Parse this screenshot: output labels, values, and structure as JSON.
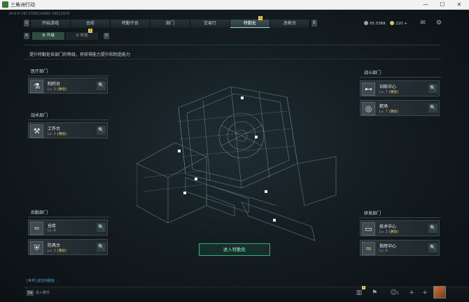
{
  "window": {
    "title": "三角洲行动",
    "min": "—",
    "max": "☐",
    "close": "✕"
  },
  "uid": "24-6-8 UID 0786524880 39521829",
  "topnav": {
    "key_left": "Q",
    "key_right": "E",
    "tabs": [
      {
        "label": "开始游戏"
      },
      {
        "label": "仓库"
      },
      {
        "label": "特勤干员"
      },
      {
        "label": "部门"
      },
      {
        "label": "交易行"
      },
      {
        "label": "特勤处",
        "badge": "1"
      },
      {
        "label": "改枪台"
      }
    ]
  },
  "stats": {
    "currency": "95.53BK",
    "coins": "220"
  },
  "subnav": {
    "key_left": "A",
    "key_right": "D",
    "tabs": [
      {
        "label": "升级"
      },
      {
        "label": "制造",
        "badge": "1"
      }
    ]
  },
  "description": "提升特勤处各部门的等级，将获得能力提升和制造能力",
  "departments": {
    "medical": {
      "label": "医疗部门",
      "items": [
        {
          "name": "制药台",
          "level": "Lv. 3",
          "max": "(满级)",
          "icon": "flask-icon"
        }
      ]
    },
    "tactical": {
      "label": "战术部门",
      "items": [
        {
          "name": "工作台",
          "level": "Lv. 3",
          "max": "(满级)",
          "icon": "tools-icon"
        }
      ]
    },
    "logistics": {
      "label": "后勤部门",
      "items": [
        {
          "name": "仓库",
          "level": "Lv. 6",
          "max": "",
          "icon": "rank-chevron-icon"
        },
        {
          "name": "防具台",
          "level": "Lv. 3",
          "max": "(满级)",
          "icon": "armor-icon"
        }
      ]
    },
    "combat": {
      "label": "战斗部门",
      "items": [
        {
          "name": "训练中心",
          "level": "Lv. 7",
          "max": "(满级)",
          "icon": "dumbbell-icon"
        },
        {
          "name": "靶场",
          "level": "Lv. 7",
          "max": "(满级)",
          "icon": "target-icon"
        }
      ]
    },
    "research": {
      "label": "研发部门",
      "items": [
        {
          "name": "技术中心",
          "level": "Lv. 3",
          "max": "(满级)",
          "icon": "monitor-icon"
        },
        {
          "name": "指挥中心",
          "level": "Lv. 6",
          "max": "",
          "icon": "rank-chevron-icon"
        }
      ]
    }
  },
  "enter_button": "进入特勤处",
  "chat": {
    "message": "[世界] 前往特勤处 ...",
    "key": "Tab",
    "hint": "进入聊天"
  },
  "bottom": {
    "badge": "1",
    "count": "1"
  },
  "colors": {
    "accent": "#3aa97a",
    "gold": "#d9c268",
    "background": "#0e1519"
  }
}
